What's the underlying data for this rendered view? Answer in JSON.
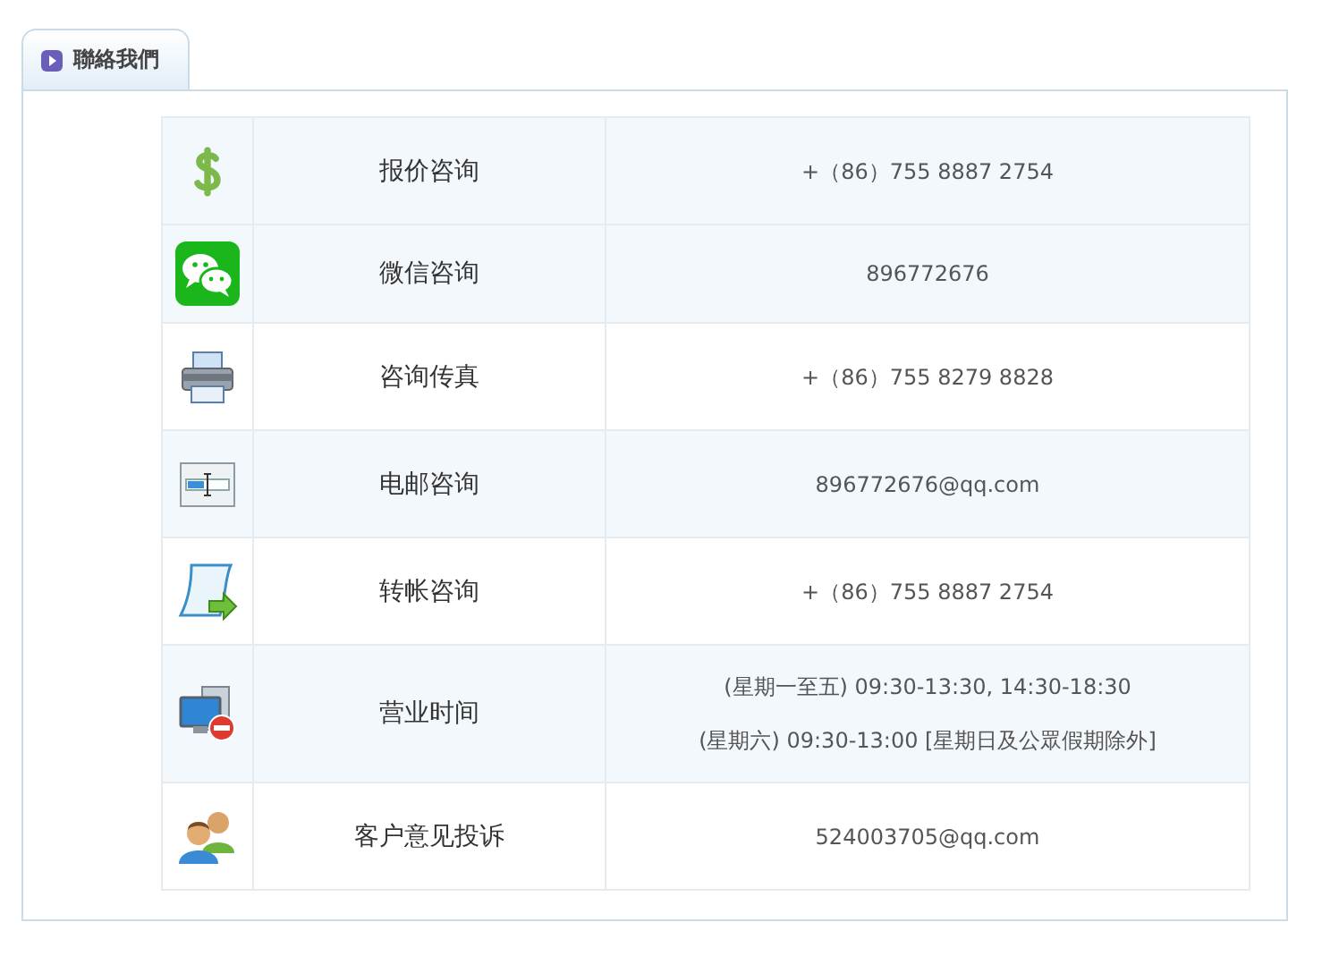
{
  "tab": {
    "label": "聯絡我們",
    "selected": true
  },
  "rows": [
    {
      "kind": "dollar",
      "label": "报价咨询",
      "shaded": true,
      "lines": [
        "+（86）755 8887 2754"
      ]
    },
    {
      "kind": "chat",
      "label": "微信咨询",
      "shaded": true,
      "lines": [
        "896772676"
      ]
    },
    {
      "kind": "printer",
      "label": "咨询传真",
      "shaded": false,
      "lines": [
        "+（86）755 8279 8828"
      ]
    },
    {
      "kind": "window",
      "label": "电邮咨询",
      "shaded": true,
      "lines": [
        "896772676@qq.com"
      ]
    },
    {
      "kind": "scroll",
      "label": "转帐咨询",
      "shaded": false,
      "lines": [
        "+（86）755 8887 2754"
      ]
    },
    {
      "kind": "computer",
      "label": "营业时间",
      "shaded": true,
      "lines": [
        "(星期一至五) 09:30-13:30, 14:30-18:30",
        "(星期六) 09:30-13:00 [星期日及公眾假期除外]"
      ]
    },
    {
      "kind": "users",
      "label": "客户意见投诉",
      "shaded": false,
      "lines": [
        "524003705@qq.com"
      ]
    }
  ]
}
